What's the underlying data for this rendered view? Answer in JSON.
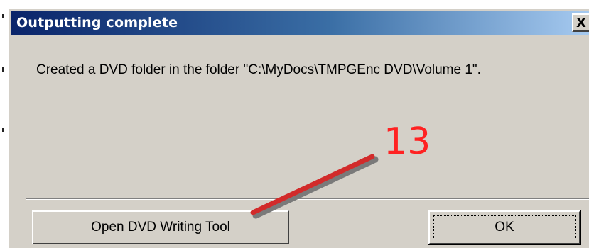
{
  "dialog": {
    "title": "Outputting complete",
    "close_label": "X",
    "message": "Created a DVD folder in the folder \"C:\\MyDocs\\TMPGEnc DVD\\Volume 1\".",
    "buttons": {
      "open_tool_label": "Open DVD Writing Tool",
      "ok_label": "OK"
    }
  },
  "annotation": {
    "step_number": "13",
    "color": "#ff2222"
  },
  "colors": {
    "title_bar_start": "#0a246a",
    "title_bar_end": "#a6caf0",
    "dialog_face": "#d4d0c8"
  }
}
